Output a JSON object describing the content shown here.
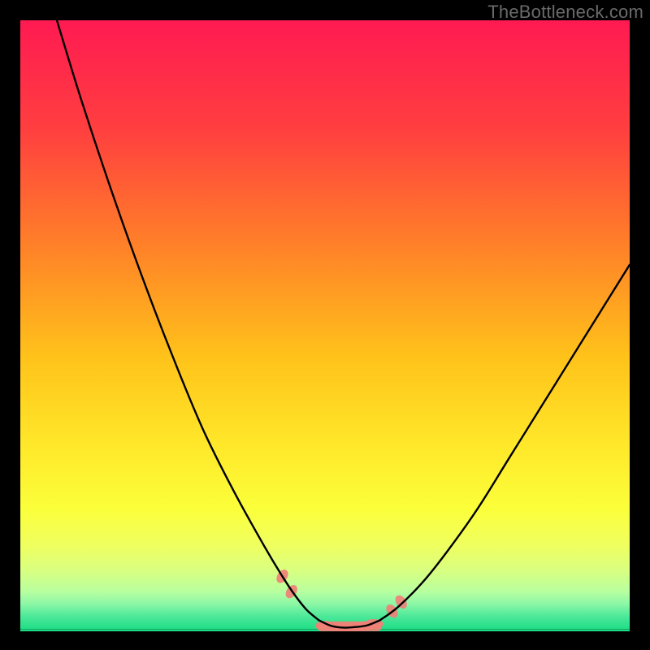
{
  "watermark": "TheBottleneck.com",
  "chart_data": {
    "type": "line",
    "title": "",
    "xlabel": "",
    "ylabel": "",
    "xlim": [
      0,
      100
    ],
    "ylim": [
      0,
      100
    ],
    "grid": false,
    "legend": false,
    "description": "Bottleneck curve: two black branches descending from top-left and top-right meeting at a flat minimum near x≈53, over a rainbow gradient (red through green). A thin green band runs along the bottom; small pink marker clusters sit at the valley floor and on the lower slopes of each branch.",
    "series": [
      {
        "name": "left-branch",
        "x": [
          6,
          10,
          15,
          20,
          25,
          30,
          35,
          40,
          43,
          45,
          47,
          49
        ],
        "y": [
          100,
          87,
          72,
          58,
          45,
          33,
          23,
          14,
          9,
          6,
          3.5,
          1.8
        ]
      },
      {
        "name": "valley-floor",
        "x": [
          49,
          51,
          53,
          55,
          57,
          59
        ],
        "y": [
          1.8,
          0.9,
          0.6,
          0.7,
          1.0,
          1.8
        ]
      },
      {
        "name": "right-branch",
        "x": [
          59,
          62,
          66,
          70,
          75,
          80,
          85,
          90,
          95,
          100
        ],
        "y": [
          1.8,
          4,
          8,
          13,
          20,
          28,
          36,
          44,
          52,
          60
        ]
      }
    ],
    "markers": [
      {
        "name": "left-slope-cluster",
        "x": 43,
        "y": 9
      },
      {
        "name": "left-slope-cluster-2",
        "x": 44.5,
        "y": 6.5
      },
      {
        "name": "valley-cluster",
        "x": 50,
        "y": 0.9
      },
      {
        "name": "valley-cluster",
        "x": 52,
        "y": 0.6
      },
      {
        "name": "valley-cluster",
        "x": 54,
        "y": 0.6
      },
      {
        "name": "valley-cluster",
        "x": 56,
        "y": 0.8
      },
      {
        "name": "valley-cluster",
        "x": 58,
        "y": 1.2
      },
      {
        "name": "right-slope-cluster",
        "x": 61,
        "y": 3.3
      },
      {
        "name": "right-slope-cluster-2",
        "x": 62.5,
        "y": 4.8
      }
    ],
    "gradient_stops": [
      {
        "pos": 0.0,
        "color": "#ff1a52"
      },
      {
        "pos": 0.18,
        "color": "#ff3f3f"
      },
      {
        "pos": 0.35,
        "color": "#ff7a2a"
      },
      {
        "pos": 0.55,
        "color": "#ffc21a"
      },
      {
        "pos": 0.7,
        "color": "#ffe92a"
      },
      {
        "pos": 0.8,
        "color": "#fbff3a"
      },
      {
        "pos": 0.86,
        "color": "#efff60"
      },
      {
        "pos": 0.9,
        "color": "#d9ff80"
      },
      {
        "pos": 0.935,
        "color": "#b8ffa0"
      },
      {
        "pos": 0.955,
        "color": "#8cf7a6"
      },
      {
        "pos": 0.975,
        "color": "#4ee89a"
      },
      {
        "pos": 1.0,
        "color": "#18dc82"
      }
    ]
  }
}
